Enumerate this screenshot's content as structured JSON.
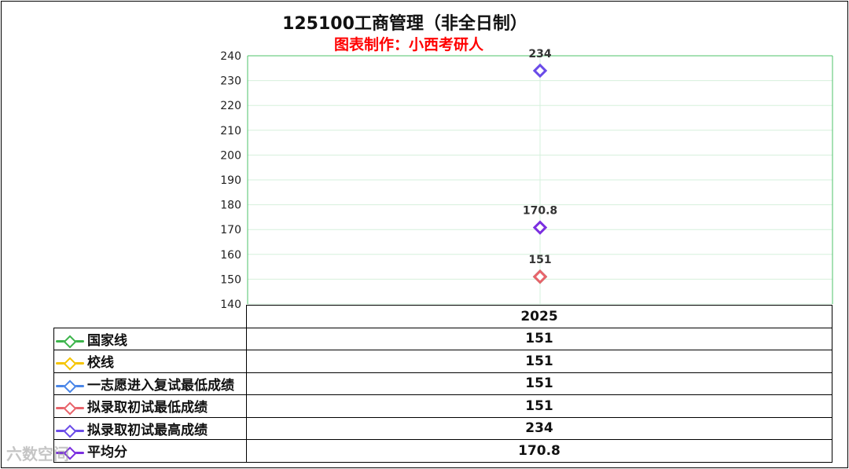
{
  "chart_data": {
    "type": "scatter",
    "title": "125100工商管理（非全日制）",
    "subtitle": "图表制作：小西考研人",
    "categories": [
      "2025"
    ],
    "y_ticks": [
      240,
      230,
      220,
      210,
      200,
      190,
      180,
      170,
      160,
      150,
      140
    ],
    "ylim": [
      140,
      240
    ],
    "grid": true,
    "series": [
      {
        "name": "国家线",
        "color": "#3cb44b",
        "values": [
          151
        ],
        "value_label": "151"
      },
      {
        "name": "校线",
        "color": "#f5c400",
        "values": [
          151
        ],
        "value_label": "151"
      },
      {
        "name": "一志愿进入复试最低成绩",
        "color": "#4a86e8",
        "values": [
          151
        ],
        "value_label": "151"
      },
      {
        "name": "拟录取初试最低成绩",
        "color": "#e8646b",
        "values": [
          151
        ],
        "value_label": "151"
      },
      {
        "name": "拟录取初试最高成绩",
        "color": "#6a4be8",
        "values": [
          234
        ],
        "value_label": "234"
      },
      {
        "name": "平均分",
        "color": "#7b2fe0",
        "values": [
          170.8
        ],
        "value_label": "170.8"
      }
    ],
    "point_labels": [
      {
        "series_index": 4,
        "text": "234"
      },
      {
        "series_index": 5,
        "text": "170.8"
      },
      {
        "series_index": 3,
        "text": "151"
      }
    ]
  },
  "watermark": "六数空间"
}
